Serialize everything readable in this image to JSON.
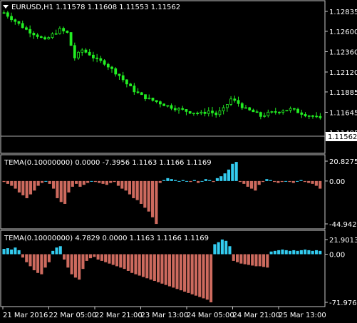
{
  "colors": {
    "background": "#000000",
    "frame": "#c8c8c8",
    "text": "#ffffff",
    "candle": "#22ee22",
    "hist_pos": "#33ccf0",
    "hist_neg": "#cd6a5e",
    "price_line": "#aaaaaa"
  },
  "main_panel": {
    "header": "EURUSD,H1  1.11578 1.11608 1.11553 1.11562",
    "menu_icon": "triangle-down-icon",
    "price_ticks": [
      "1.12835",
      "1.12600",
      "1.12360",
      "1.12120",
      "1.11885",
      "1.11645",
      "1.11405"
    ],
    "current_price": "1.11562"
  },
  "indicator_1": {
    "header": "TEMA(0.10000000) 0.0000 -7.3956 1.1163 1.1166 1.1169",
    "ticks": [
      "20.8275",
      "0.00",
      "-44.9424"
    ]
  },
  "indicator_2": {
    "header": "TEMA(0.10000000) 4.7829 0.0000 1.1163 1.1166 1.1169",
    "ticks": [
      "21.9013",
      "0.00",
      "-71.9766"
    ]
  },
  "time_axis": {
    "labels": [
      "21 Mar 2016",
      "22 Mar 05:00",
      "22 Mar 21:00",
      "23 Mar 13:00",
      "24 Mar 05:00",
      "24 Mar 21:00",
      "25 Mar 13:00"
    ]
  },
  "chart_data": [
    {
      "type": "candlestick",
      "title": "EURUSD,H1",
      "ylim": [
        1.11405,
        1.12835
      ],
      "close_path": [
        [
          0,
          1.1282
        ],
        [
          3,
          1.1272
        ],
        [
          6,
          1.1262
        ],
        [
          9,
          1.1255
        ],
        [
          11,
          1.1249
        ],
        [
          13,
          1.1256
        ],
        [
          15,
          1.1262
        ],
        [
          17,
          1.1258
        ],
        [
          19,
          1.1229
        ],
        [
          21,
          1.1238
        ],
        [
          23,
          1.1233
        ],
        [
          25,
          1.1226
        ],
        [
          27,
          1.1223
        ],
        [
          29,
          1.1215
        ],
        [
          31,
          1.1208
        ],
        [
          33,
          1.1198
        ],
        [
          35,
          1.119
        ],
        [
          37,
          1.1184
        ],
        [
          39,
          1.118
        ],
        [
          41,
          1.1177
        ],
        [
          44,
          1.1172
        ],
        [
          47,
          1.1168
        ],
        [
          50,
          1.1165
        ],
        [
          53,
          1.1163
        ],
        [
          55,
          1.1166
        ],
        [
          57,
          1.1162
        ],
        [
          59,
          1.1168
        ],
        [
          61,
          1.118
        ],
        [
          63,
          1.1175
        ],
        [
          65,
          1.1168
        ],
        [
          67,
          1.1165
        ],
        [
          69,
          1.116
        ],
        [
          71,
          1.1163
        ],
        [
          73,
          1.1165
        ],
        [
          75,
          1.1167
        ],
        [
          77,
          1.1168
        ],
        [
          79,
          1.1165
        ],
        [
          81,
          1.1162
        ],
        [
          83,
          1.116
        ],
        [
          85,
          1.11562
        ]
      ],
      "bar_count": 86
    },
    {
      "type": "bar",
      "title": "TEMA(0.10000000) 0.0000 -7.3956 1.1163 1.1166 1.1169",
      "ylim": [
        -44.9424,
        20.8275
      ],
      "values": [
        -1,
        -3,
        -5,
        -8,
        -12,
        -15,
        -18,
        -14,
        -10,
        -5,
        -2,
        0,
        -3,
        -8,
        -18,
        -22,
        -24,
        -12,
        -6,
        -3,
        -6,
        -4,
        -2,
        0,
        -1,
        -2,
        -3,
        -4,
        -2,
        -1,
        -5,
        -8,
        -10,
        -14,
        -18,
        -20,
        -24,
        -28,
        -32,
        -38,
        -45,
        -2,
        1,
        3,
        2,
        1,
        0,
        1,
        0,
        -1,
        1,
        -2,
        0,
        2,
        1,
        -1,
        3,
        5,
        8,
        12,
        18,
        20,
        -1,
        -3,
        -6,
        -8,
        -10,
        -4,
        -1,
        2,
        1,
        -1,
        -2,
        -1,
        0,
        -1,
        -2,
        0,
        1,
        -1,
        -2,
        -3,
        -5,
        -8
      ]
    },
    {
      "type": "bar",
      "title": "TEMA(0.10000000) 4.7829 0.0000 1.1163 1.1166 1.1169",
      "ylim": [
        -71.9766,
        21.9013
      ],
      "values": [
        8,
        9,
        7,
        10,
        6,
        -5,
        -12,
        -18,
        -24,
        -28,
        -30,
        -20,
        -12,
        5,
        10,
        12,
        -8,
        -20,
        -30,
        -35,
        -38,
        -22,
        -10,
        -6,
        -4,
        -8,
        -10,
        -12,
        -14,
        -16,
        -18,
        -20,
        -22,
        -25,
        -28,
        -30,
        -32,
        -34,
        -36,
        -38,
        -40,
        -42,
        -44,
        -46,
        -48,
        -50,
        -52,
        -54,
        -56,
        -58,
        -60,
        -62,
        -64,
        -66,
        -68,
        -72,
        15,
        18,
        22,
        20,
        12,
        -10,
        -12,
        -14,
        -15,
        -16,
        -17,
        -18,
        -18,
        -19,
        -20,
        4,
        5,
        6,
        7,
        6,
        5,
        6,
        5,
        6,
        7,
        6,
        5,
        6,
        5
      ]
    }
  ]
}
